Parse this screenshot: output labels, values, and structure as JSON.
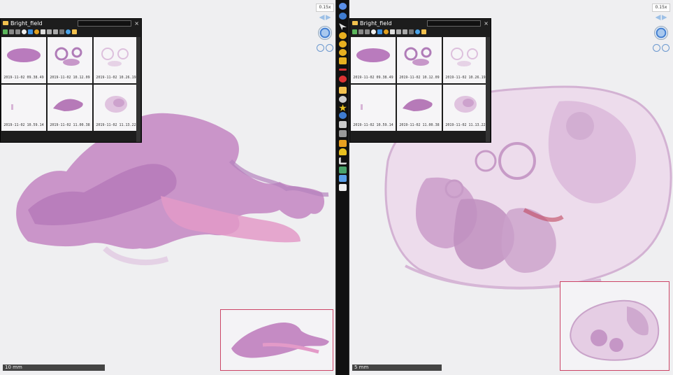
{
  "left_pane": {
    "browser": {
      "folder_name": "Bright_field",
      "close_label": "×",
      "thumbnails": [
        {
          "caption": "2019-11-02 09.38.49"
        },
        {
          "caption": "2019-11-02 10.12.09"
        },
        {
          "caption": "2019-11-02 10.26.19"
        },
        {
          "caption": "2019-11-02 10.59.14"
        },
        {
          "caption": "2019-11-02 11.00.38"
        },
        {
          "caption": "2019-11-02 11.13.22"
        }
      ]
    },
    "magnification": "0.15x",
    "scale_label": "10 mm"
  },
  "right_pane": {
    "browser": {
      "folder_name": "Bright_field",
      "close_label": "×",
      "thumbnails": [
        {
          "caption": "2019-11-02 09.38.49"
        },
        {
          "caption": "2019-11-02 10.12.09"
        },
        {
          "caption": "2019-11-02 10.26.19"
        },
        {
          "caption": "2019-11-02 10.59.14"
        },
        {
          "caption": "2019-11-02 11.00.38"
        },
        {
          "caption": "2019-11-02 11.13.22"
        }
      ]
    },
    "magnification": "0.15x",
    "scale_label": "5 mm"
  },
  "toolbar_tools": [
    "sync-icon",
    "refresh-icon",
    "pointer-icon",
    "circle-annotation-icon",
    "ruler-icon",
    "no-entry-icon",
    "pen-icon",
    "pin-icon",
    "folder-icon",
    "settings-icon",
    "star-icon",
    "info-icon",
    "keyboard-icon",
    "grid-icon",
    "pencil-icon",
    "person-icon",
    "angle-icon",
    "layers-icon",
    "tag-icon",
    "document-icon"
  ],
  "colors": {
    "tissue_pink": "#c98ac0",
    "tissue_light": "#e6c6e0",
    "overview_border": "#cc4466"
  }
}
